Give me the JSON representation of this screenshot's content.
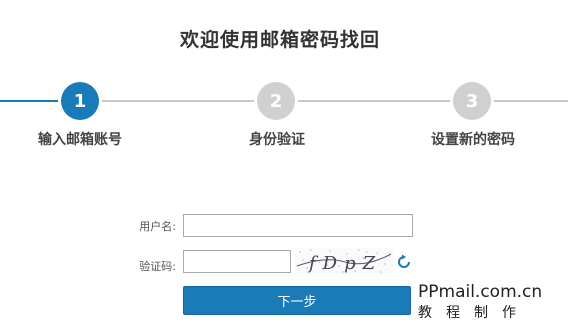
{
  "page": {
    "title": "欢迎使用邮箱密码找回"
  },
  "steps": [
    {
      "number": "1",
      "label": "输入邮箱账号",
      "active": true
    },
    {
      "number": "2",
      "label": "身份验证",
      "active": false
    },
    {
      "number": "3",
      "label": "设置新的密码",
      "active": false
    }
  ],
  "form": {
    "username_label": "用户名:",
    "username_value": "",
    "captcha_label": "验证码:",
    "captcha_value": "",
    "captcha_text": "fDpZ",
    "next_button": "下一步"
  },
  "watermark": {
    "line1": "PPmail.com.cn",
    "line2": "教程制作"
  },
  "colors": {
    "accent": "#1a7bb9",
    "inactive": "#d0d0d0"
  }
}
